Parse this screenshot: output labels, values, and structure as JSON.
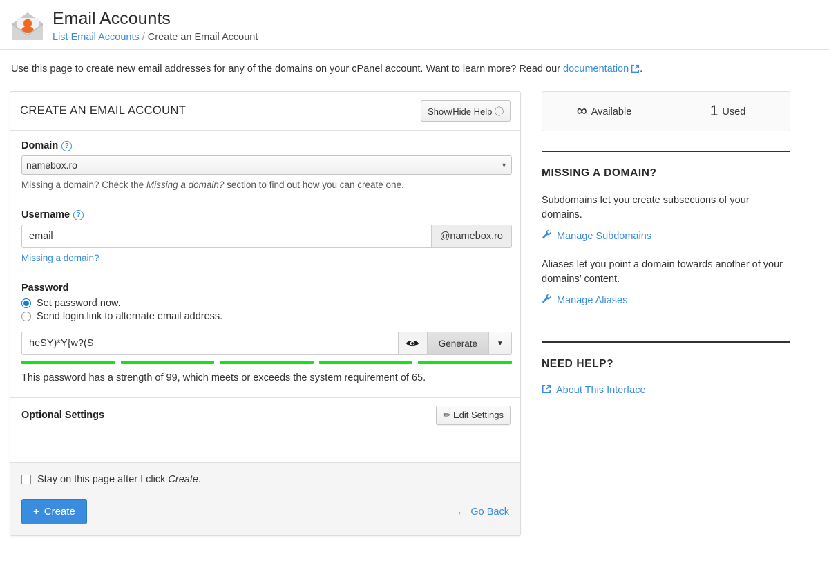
{
  "header": {
    "icon": "email-accounts-icon",
    "title": "Email Accounts",
    "breadcrumb_link": "List Email Accounts",
    "breadcrumb_sep": "/",
    "breadcrumb_current": "Create an Email Account"
  },
  "intro": {
    "text_before": "Use this page to create new email addresses for any of the domains on your cPanel account. Want to learn more? Read our ",
    "link": "documentation",
    "text_after": "."
  },
  "panel": {
    "title": "CREATE AN EMAIL ACCOUNT",
    "help_button": "Show/Hide Help",
    "help_button_icon": "question-circle-icon"
  },
  "domain": {
    "label": "Domain",
    "help_icon": "question-circle-icon",
    "selected": "namebox.ro",
    "options": [
      "namebox.ro"
    ],
    "hint_before": "Missing a domain? Check the ",
    "hint_em": "Missing a domain?",
    "hint_after": " section to find out how you can create one."
  },
  "username": {
    "label": "Username",
    "help_icon": "question-circle-icon",
    "value": "email",
    "placeholder": "email",
    "addon": "@namebox.ro",
    "missing_link": "Missing a domain?"
  },
  "password": {
    "label": "Password",
    "option_set_now": "Set password now.",
    "option_send_link": "Send login link to alternate email address.",
    "selected_option": "set_now",
    "value": "heSY)*Y{w?(S",
    "show_icon": "eye-icon",
    "generate_label": "Generate",
    "caret_icon": "caret-down-icon",
    "strength_segments": 5,
    "strength_color": "#12e512",
    "strength_text": "This password has a strength of 99, which meets or exceeds the system requirement of 65.",
    "strength_value": 99,
    "strength_required": 65
  },
  "optional": {
    "title": "Optional Settings",
    "edit_label": "Edit Settings",
    "edit_icon": "pencil-icon"
  },
  "footer": {
    "stay_checkbox_before": "Stay on this page after I click ",
    "stay_checkbox_em": "Create",
    "stay_checkbox_after": ".",
    "stay_checked": false,
    "create_label": "Create",
    "create_icon": "plus-icon",
    "go_back_label": "Go Back",
    "go_back_icon": "arrow-left-icon"
  },
  "sidebar": {
    "available_value": "∞",
    "available_label": "Available",
    "used_value": "1",
    "used_label": "Used",
    "missing_domain": {
      "heading": "MISSING A DOMAIN?",
      "para1": "Subdomains let you create subsections of your domains.",
      "link1": "Manage Subdomains",
      "link1_icon": "wrench-icon",
      "para2": "Aliases let you point a domain towards another of your domains’ content.",
      "link2": "Manage Aliases",
      "link2_icon": "wrench-icon"
    },
    "need_help": {
      "heading": "NEED HELP?",
      "link": "About This Interface",
      "link_icon": "external-link-icon"
    }
  },
  "colors": {
    "accent": "#3a8dde",
    "strength": "#12e512",
    "icon_orange": "#f26722",
    "page_bg": "#f4f4f4"
  }
}
